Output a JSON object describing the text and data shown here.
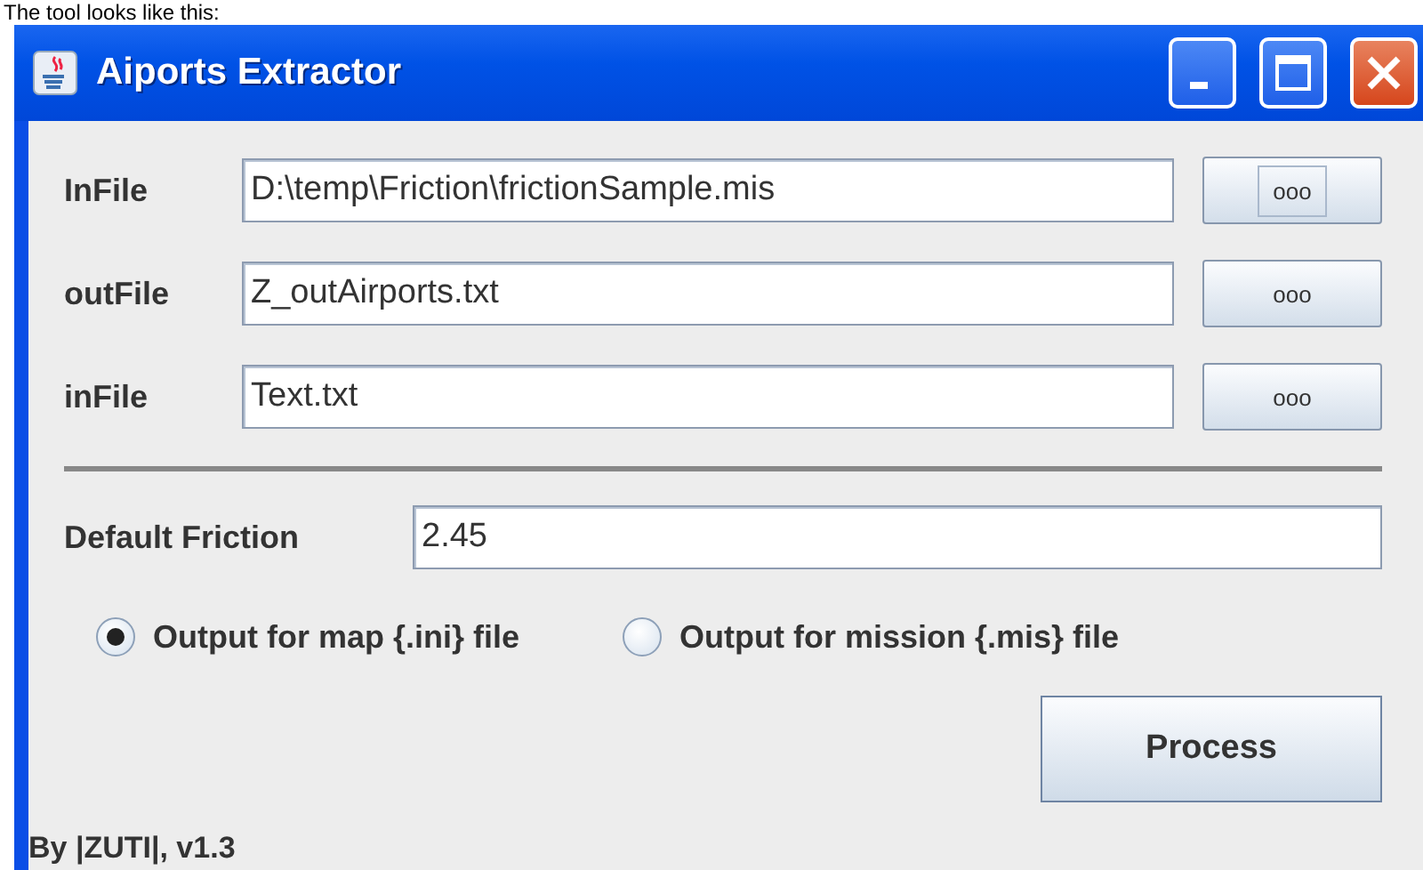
{
  "caption": "The tool looks like this:",
  "window": {
    "title": "Aiports Extractor"
  },
  "file_rows": [
    {
      "label": "InFile",
      "value": "D:\\temp\\Friction\\frictionSample.mis",
      "button": "ooo",
      "focused": true
    },
    {
      "label": "outFile",
      "value": "Z_outAirports.txt",
      "button": "ooo",
      "focused": false
    },
    {
      "label": "inFile",
      "value": "Text.txt",
      "button": "ooo",
      "focused": false
    }
  ],
  "friction": {
    "label": "Default Friction",
    "value": "2.45"
  },
  "output_options": [
    {
      "label": "Output for map {.ini} file",
      "selected": true
    },
    {
      "label": "Output for mission {.mis} file",
      "selected": false
    }
  ],
  "process_button": "Process",
  "footer": "By |ZUTI|,  v1.3"
}
